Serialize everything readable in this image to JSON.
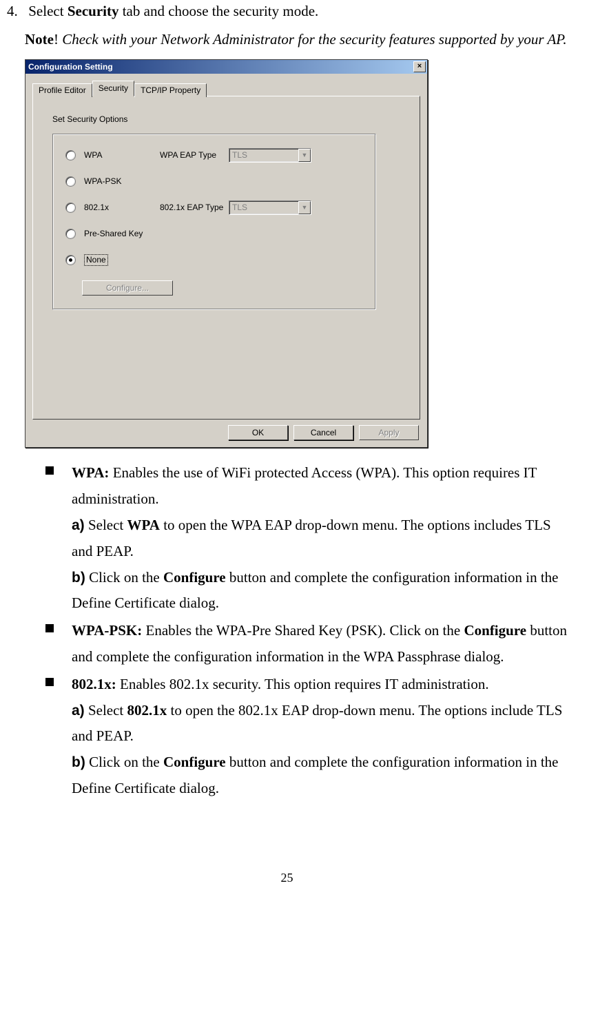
{
  "page_number": "25",
  "step": {
    "num": "4.",
    "line1a": "Select ",
    "line1b": "Security",
    "line1c": " tab and choose the security mode.",
    "note_label": "Note",
    "note_bang": "! ",
    "note_text": "Check with your Network Administrator for the security features supported by your AP."
  },
  "dialog": {
    "title": "Configuration Setting",
    "close": "×",
    "tabs": {
      "profile": "Profile Editor",
      "security": "Security",
      "tcpip": "TCP/IP Property"
    },
    "sec_label": "Set Security Options",
    "options": {
      "wpa": "WPA",
      "wpapsk": "WPA-PSK",
      "dot1x": "802.1x",
      "psk": "Pre-Shared Key",
      "none": "None"
    },
    "eap": {
      "wpa_label": "WPA EAP Type",
      "dot1x_label": "802.1x EAP Type",
      "value": "TLS"
    },
    "configure": "Configure...",
    "ok": "OK",
    "cancel": "Cancel",
    "apply": "Apply"
  },
  "bullets": {
    "wpa": {
      "head": "WPA:",
      "text": " Enables the use of WiFi protected Access (WPA). This option requires IT administration.",
      "a_prefix": "a)",
      "a_1": " Select ",
      "a_bold": "WPA",
      "a_2": " to open the WPA EAP drop-down menu. The options includes TLS and PEAP.",
      "b_prefix": "b)",
      "b_1": " Click on the ",
      "b_bold": "Configure",
      "b_2": " button and complete the configuration information in the Define Certificate dialog."
    },
    "wpapsk": {
      "head": "WPA-PSK:",
      "t1": " Enables the WPA-Pre Shared Key (PSK). Click on the ",
      "bold": "Configure",
      "t2": " button and complete the configuration information in the WPA Passphrase dialog."
    },
    "dot1x": {
      "head": "802.1x:",
      "text": " Enables 802.1x security. This option requires IT administration.",
      "a_prefix": "a)",
      "a_1": " Select ",
      "a_bold": "802.1x",
      "a_2": " to open the 802.1x EAP drop-down menu. The options include TLS and PEAP.",
      "b_prefix": "b)",
      "b_1": " Click on the ",
      "b_bold": "Configure",
      "b_2": " button and complete the configuration information in the Define Certificate dialog."
    }
  }
}
